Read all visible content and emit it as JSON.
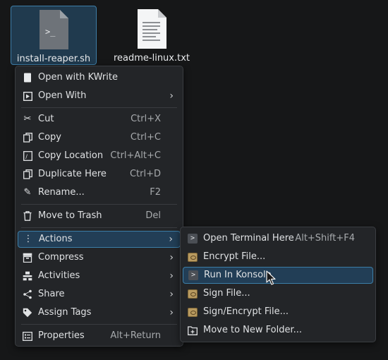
{
  "desktop": {
    "files": [
      {
        "name": "install-reaper.sh",
        "selected": true,
        "icon": "shell-script-icon"
      },
      {
        "name": "readme-linux.txt",
        "selected": false,
        "icon": "text-file-icon"
      }
    ]
  },
  "context_menu": {
    "items": [
      {
        "label": "Open with KWrite",
        "icon": "kwrite-icon",
        "shortcut": "",
        "submenu": false
      },
      {
        "label": "Open With",
        "icon": "open-with-icon",
        "shortcut": "",
        "submenu": true
      },
      {
        "label": "Cut",
        "icon": "scissors-icon",
        "shortcut": "Ctrl+X",
        "submenu": false
      },
      {
        "label": "Copy",
        "icon": "copy-icon",
        "shortcut": "Ctrl+C",
        "submenu": false
      },
      {
        "label": "Copy Location",
        "icon": "copy-location-icon",
        "shortcut": "Ctrl+Alt+C",
        "submenu": false
      },
      {
        "label": "Duplicate Here",
        "icon": "duplicate-icon",
        "shortcut": "Ctrl+D",
        "submenu": false
      },
      {
        "label": "Rename...",
        "icon": "pencil-icon",
        "shortcut": "F2",
        "submenu": false
      },
      {
        "label": "Move to Trash",
        "icon": "trash-icon",
        "shortcut": "Del",
        "submenu": false
      },
      {
        "label": "Actions",
        "icon": "more-vertical-icon",
        "shortcut": "",
        "submenu": true,
        "highlighted": true
      },
      {
        "label": "Compress",
        "icon": "archive-icon",
        "shortcut": "",
        "submenu": true
      },
      {
        "label": "Activities",
        "icon": "activities-icon",
        "shortcut": "",
        "submenu": true
      },
      {
        "label": "Share",
        "icon": "share-icon",
        "shortcut": "",
        "submenu": true
      },
      {
        "label": "Assign Tags",
        "icon": "tag-icon",
        "shortcut": "",
        "submenu": true
      },
      {
        "label": "Properties",
        "icon": "properties-icon",
        "shortcut": "Alt+Return",
        "submenu": false
      }
    ]
  },
  "actions_submenu": {
    "items": [
      {
        "label": "Open Terminal Here",
        "icon": "terminal-icon",
        "shortcut": "Alt+Shift+F4"
      },
      {
        "label": "Encrypt File...",
        "icon": "gpg-key-icon",
        "shortcut": ""
      },
      {
        "label": "Run In Konsole",
        "icon": "terminal-icon",
        "shortcut": "",
        "highlighted": true
      },
      {
        "label": "Sign File...",
        "icon": "gpg-key-icon",
        "shortcut": ""
      },
      {
        "label": "Sign/Encrypt File...",
        "icon": "gpg-key-icon",
        "shortcut": ""
      },
      {
        "label": "Move to New Folder...",
        "icon": "new-folder-icon",
        "shortcut": ""
      }
    ]
  },
  "colors": {
    "background": "#161718",
    "menu_background": "#232528",
    "highlight_fill": "#223e56",
    "highlight_border": "#3c7ea8"
  }
}
